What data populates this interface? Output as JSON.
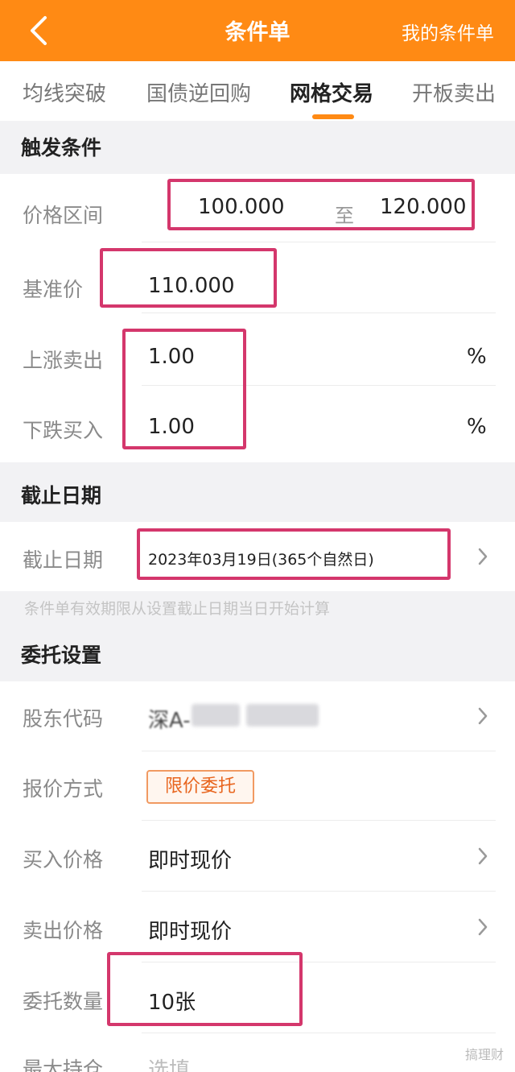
{
  "header": {
    "title": "条件单",
    "right_link": "我的条件单"
  },
  "tabs": [
    {
      "label": "均线突破"
    },
    {
      "label": "国债逆回购"
    },
    {
      "label": "网格交易",
      "active": true
    },
    {
      "label": "开板卖出"
    }
  ],
  "trigger": {
    "section_title": "触发条件",
    "price_range_label": "价格区间",
    "price_from": "100.000",
    "range_to": "至",
    "price_to": "120.000",
    "base_price_label": "基准价",
    "base_price": "110.000",
    "rise_sell_label": "上涨卖出",
    "rise_sell_value": "1.00",
    "fall_buy_label": "下跌买入",
    "fall_buy_value": "1.00",
    "percent": "%"
  },
  "deadline": {
    "section_title": "截止日期",
    "label": "截止日期",
    "value": "2023年03月19日(365个自然日)",
    "note": "条件单有效期限从设置截止日期当日开始计算"
  },
  "entrust": {
    "section_title": "委托设置",
    "shareholder_label": "股东代码",
    "shareholder_value": "深A-",
    "quote_label": "报价方式",
    "quote_value": "限价委托",
    "buy_price_label": "买入价格",
    "buy_price_value": "即时现价",
    "sell_price_label": "卖出价格",
    "sell_price_value": "即时现价",
    "qty_label": "委托数量",
    "qty_value": "10张",
    "max_hold_label": "最大持仓",
    "max_hold_placeholder": "选填"
  },
  "watermark": "搞理财",
  "colors": {
    "accent": "#ff8a14",
    "highlight": "#d4376c",
    "tag": "#e8651e"
  }
}
